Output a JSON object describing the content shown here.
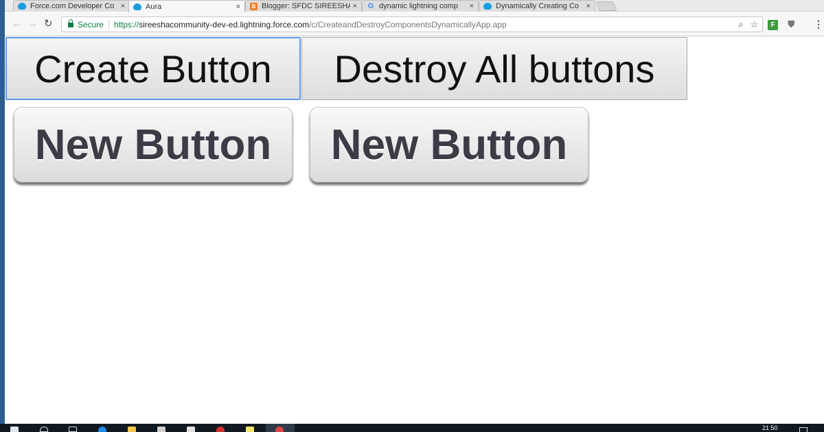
{
  "browser": {
    "tabs": [
      {
        "label": "Force.com Developer Co",
        "icon": "salesforce-cloud-icon",
        "close": "×"
      },
      {
        "label": "Aura",
        "icon": "salesforce-cloud-icon",
        "close": "×",
        "active": true
      },
      {
        "label": "Blogger: SFDC SIREESHA",
        "icon": "blogger-icon",
        "icon_text": "B",
        "close": "×"
      },
      {
        "label": "dynamic lightning comp",
        "icon": "google-icon",
        "icon_text": "G",
        "close": "×"
      },
      {
        "label": "Dynamically Creating Co",
        "icon": "salesforce-cloud-icon",
        "close": "×"
      }
    ],
    "nav": {
      "back": "←",
      "forward": "→",
      "reload": "↻"
    },
    "address": {
      "secure_label": "Secure",
      "scheme": "https://",
      "host": "sireeshacommunity-dev-ed.lightning.force.com",
      "path": "/c/CreateandDestroyComponentsDynamicallyApp.app",
      "zoom_icon": "⌕",
      "star_icon": "☆"
    },
    "extensions": {
      "green_label": "F",
      "shield": "⛊",
      "menu": "⋮"
    }
  },
  "page": {
    "create_button": "Create Button",
    "destroy_button": "Destroy All buttons",
    "new_buttons": [
      "New Button",
      "New Button"
    ]
  },
  "taskbar": {
    "time": "21:50"
  },
  "colors": {
    "accent_focus": "#5b9bea",
    "secure_green": "#0b8043",
    "salesforce_blue": "#1a9ce0",
    "blogger_orange": "#f47b20",
    "taskbar": "#101820"
  }
}
